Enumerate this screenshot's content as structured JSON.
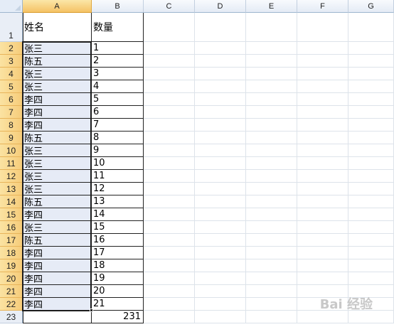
{
  "columns": [
    "A",
    "B",
    "C",
    "D",
    "E",
    "F",
    "G"
  ],
  "rows": [
    "1",
    "2",
    "3",
    "4",
    "5",
    "6",
    "7",
    "8",
    "9",
    "10",
    "11",
    "12",
    "13",
    "14",
    "15",
    "16",
    "17",
    "18",
    "19",
    "20",
    "21",
    "22",
    "23"
  ],
  "header": {
    "name": "姓名",
    "qty": "数量"
  },
  "data": [
    {
      "name": "张三",
      "qty": "1"
    },
    {
      "name": "陈五",
      "qty": "2"
    },
    {
      "name": "张三",
      "qty": "3"
    },
    {
      "name": "张三",
      "qty": "4"
    },
    {
      "name": "李四",
      "qty": "5"
    },
    {
      "name": "李四",
      "qty": "6"
    },
    {
      "name": "李四",
      "qty": "7"
    },
    {
      "name": "陈五",
      "qty": "8"
    },
    {
      "name": "张三",
      "qty": "9"
    },
    {
      "name": "张三",
      "qty": "10"
    },
    {
      "name": "张三",
      "qty": "11"
    },
    {
      "name": "张三",
      "qty": "12"
    },
    {
      "name": "陈五",
      "qty": "13"
    },
    {
      "name": "李四",
      "qty": "14"
    },
    {
      "name": "张三",
      "qty": "15"
    },
    {
      "name": "陈五",
      "qty": "16"
    },
    {
      "name": "李四",
      "qty": "17"
    },
    {
      "name": "李四",
      "qty": "18"
    },
    {
      "name": "李四",
      "qty": "19"
    },
    {
      "name": "李四",
      "qty": "20"
    },
    {
      "name": "李四",
      "qty": "21"
    }
  ],
  "total": "231",
  "watermark": "Bai 经验",
  "selection": {
    "column": "A",
    "from_row": 2,
    "to_row": 22
  }
}
